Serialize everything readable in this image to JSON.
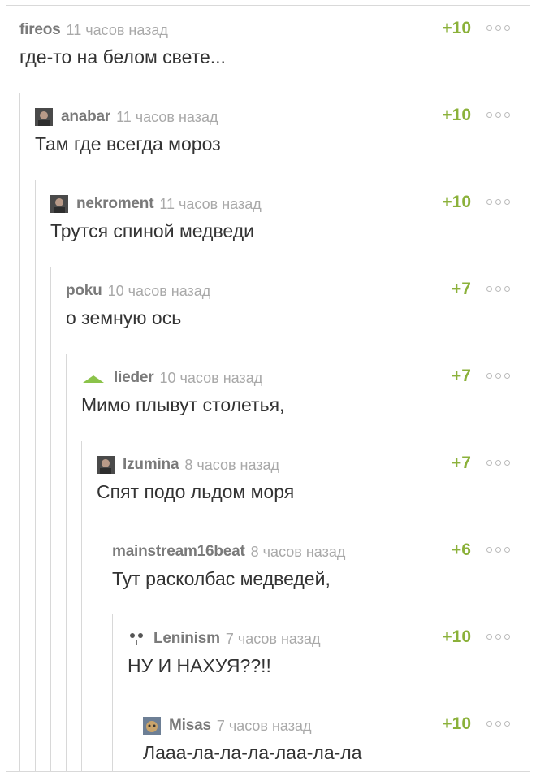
{
  "comments": [
    {
      "user": "fireos",
      "time": "11 часов назад",
      "text": "где-то на белом свете...",
      "rating": "+10",
      "avatar": "none"
    },
    {
      "user": "anabar",
      "time": "11 часов назад",
      "text": "Там где всегда мороз",
      "rating": "+10",
      "avatar": "photo"
    },
    {
      "user": "nekroment",
      "time": "11 часов назад",
      "text": "Трутся спиной медведи",
      "rating": "+10",
      "avatar": "photo"
    },
    {
      "user": "poku",
      "time": "10 часов назад",
      "text": "о земную ось",
      "rating": "+7",
      "avatar": "none"
    },
    {
      "user": "lieder",
      "time": "10 часов назад",
      "text": "Мимо плывут столетья,",
      "rating": "+7",
      "avatar": "triangle"
    },
    {
      "user": "Izumina",
      "time": "8 часов назад",
      "text": "Спят подо льдом моря",
      "rating": "+7",
      "avatar": "photo"
    },
    {
      "user": "mainstream16beat",
      "time": "8 часов назад",
      "text": "Тут расколбас медведей,",
      "rating": "+6",
      "avatar": "none"
    },
    {
      "user": "Leninism",
      "time": "7 часов назад",
      "text": "НУ И НАХУЯ??!!",
      "rating": "+10",
      "avatar": "face"
    },
    {
      "user": "Misas",
      "time": "7 часов назад",
      "text": "Лааа-ла-ла-ла-лаа-ла-ла",
      "rating": "+10",
      "avatar": "cat"
    }
  ],
  "colors": {
    "rating": "#8bb13a",
    "username": "#7a7a7a",
    "time": "#a9a9a9",
    "text": "#333333",
    "thread_line": "#d8d8d8"
  },
  "icons": {
    "more": "more-dots-icon"
  }
}
